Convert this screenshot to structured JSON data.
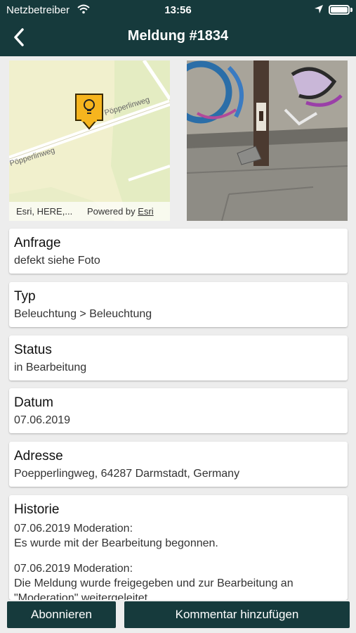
{
  "status_bar": {
    "carrier": "Netzbetreiber",
    "time": "13:56"
  },
  "header": {
    "title": "Meldung #1834"
  },
  "map": {
    "street_label_1": "Pöpperlinweg",
    "street_label_2": "Pöpperlinweg",
    "attribution_left": "Esri, HERE,...",
    "attribution_powered": "Powered by",
    "attribution_link": "Esri",
    "marker_icon": "lightbulb-icon"
  },
  "details": {
    "request": {
      "label": "Anfrage",
      "value": "defekt siehe Foto"
    },
    "type": {
      "label": "Typ",
      "value": "Beleuchtung > Beleuchtung"
    },
    "status": {
      "label": "Status",
      "value": "in Bearbeitung"
    },
    "date": {
      "label": "Datum",
      "value": "07.06.2019"
    },
    "address": {
      "label": "Adresse",
      "value": "Poepperlingweg, 64287 Darmstadt, Germany"
    },
    "history": {
      "label": "Historie",
      "entries": [
        {
          "header": "07.06.2019 Moderation:",
          "text": "Es wurde mit der Bearbeitung begonnen."
        },
        {
          "header": "07.06.2019 Moderation:",
          "text": "Die Meldung wurde freigegeben und zur Bearbeitung an \"Moderation\" weitergeleitet."
        }
      ]
    }
  },
  "actions": {
    "subscribe": "Abonnieren",
    "add_comment": "Kommentar hinzufügen"
  },
  "colors": {
    "header_bg": "#163a3c",
    "marker": "#f6b51e"
  }
}
